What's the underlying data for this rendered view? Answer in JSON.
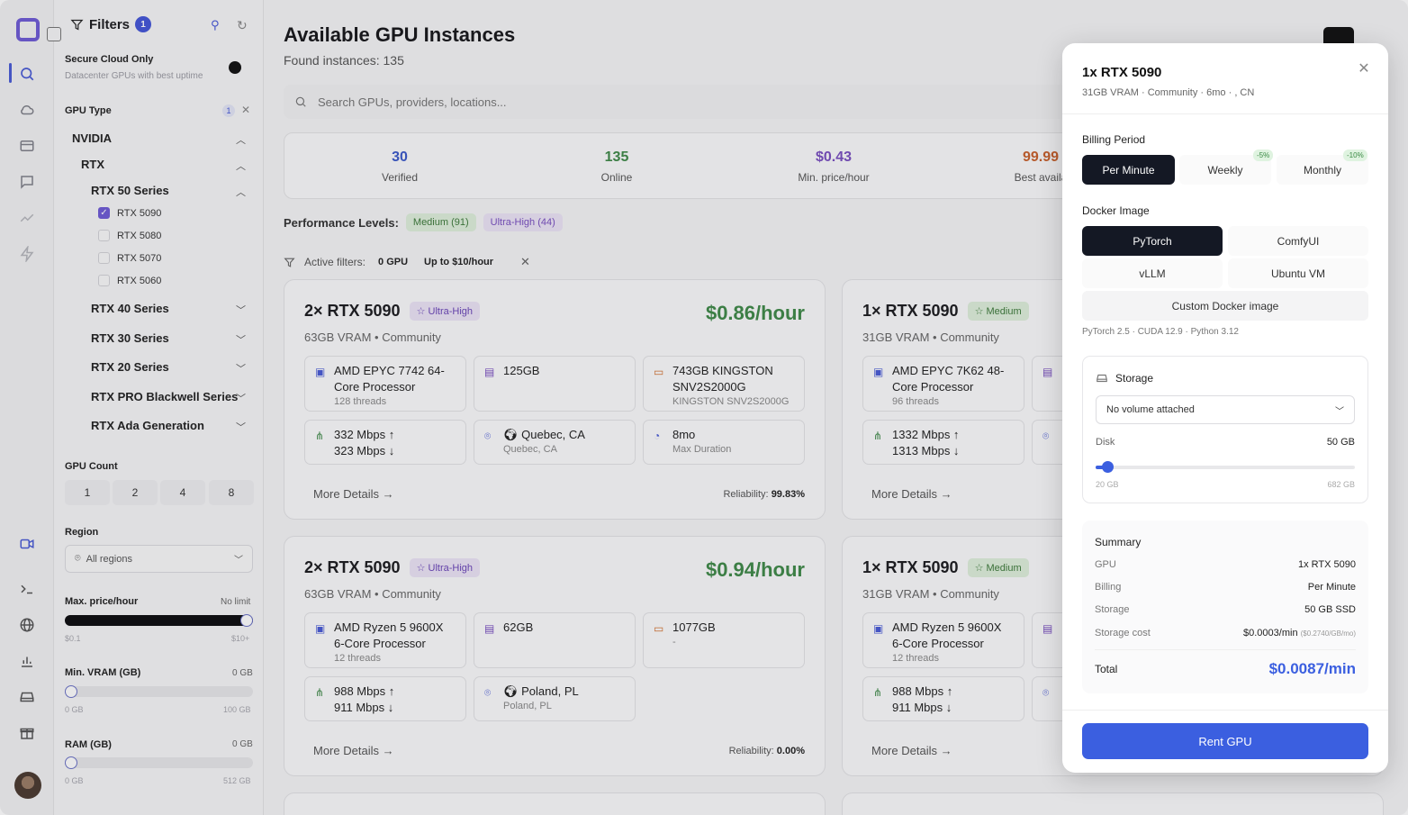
{
  "sidebar_filters": {
    "title": "Filters",
    "badge": "1",
    "secure_title": "Secure Cloud Only",
    "secure_desc": "Datacenter GPUs with best uptime",
    "gpu_type_label": "GPU Type",
    "gpu_type_count": "1",
    "vendor": "NVIDIA",
    "family": "RTX",
    "series_open": "RTX 50 Series",
    "models": [
      {
        "label": "RTX 5090",
        "checked": true
      },
      {
        "label": "RTX 5080",
        "checked": false
      },
      {
        "label": "RTX 5070",
        "checked": false
      },
      {
        "label": "RTX 5060",
        "checked": false
      }
    ],
    "series_closed": [
      "RTX 40 Series",
      "RTX 30 Series",
      "RTX 20 Series",
      "RTX PRO Blackwell Series",
      "RTX Ada Generation"
    ],
    "gpu_count_label": "GPU Count",
    "gpu_counts": [
      "1",
      "2",
      "4",
      "8"
    ],
    "region_label": "Region",
    "region_value": "All regions",
    "price_label": "Max. price/hour",
    "price_value": "No limit",
    "price_min": "$0.1",
    "price_max": "$10+",
    "price_fill": 1.0,
    "vram_label": "Min. VRAM (GB)",
    "vram_value": "0 GB",
    "vram_min": "0 GB",
    "vram_max": "100 GB",
    "ram_label": "RAM (GB)",
    "ram_value": "0 GB",
    "ram_min": "0 GB",
    "ram_max": "512 GB"
  },
  "main": {
    "title": "Available GPU Instances",
    "found": "Found instances: 135",
    "search_placeholder": "Search GPUs, providers, locations...",
    "stats": [
      {
        "value": "30",
        "label": "Verified",
        "color": "#3b59c9"
      },
      {
        "value": "135",
        "label": "Online",
        "color": "#3f8a48"
      },
      {
        "value": "$0.43",
        "label": "Min. price/hour",
        "color": "#7a4fc0"
      },
      {
        "value": "99.99",
        "label": "Best availa",
        "color": "#c8602b"
      }
    ],
    "perf_label": "Performance Levels:",
    "perf_medium": "Medium (91)",
    "perf_uh": "Ultra-High (44)",
    "active_label": "Active filters:",
    "active_chips": [
      "0 GPU",
      "Up to $10/hour"
    ],
    "more_details": "More Details",
    "reliability_label": "Reliability:"
  },
  "cards": [
    {
      "title": "2× RTX 5090",
      "tier": "Ultra-High",
      "price": "$0.86/hour",
      "sub": "63GB VRAM • Community",
      "cpu": "AMD EPYC 7742 64-Core Processor",
      "cpu_sub": "128 threads",
      "ram": "125GB",
      "disk": "743GB KINGSTON SNV2S2000G",
      "disk_sub": "KINGSTON SNV2S2000G",
      "net_up": "332 Mbps ↑",
      "net_down": "323 Mbps ↓",
      "loc": "Quebec, CA",
      "loc_sub": "Quebec, CA",
      "dur": "8mo",
      "dur_sub": "Max Duration",
      "reliability": "99.83%"
    },
    {
      "title": "1× RTX 5090",
      "tier": "Medium",
      "sub": "31GB VRAM • Community",
      "cpu": "AMD EPYC 7K62 48-Core Processor",
      "cpu_sub": "96 threads",
      "net_up": "1332 Mbps ↑",
      "net_down": "1313 Mbps ↓"
    },
    {
      "title": "2× RTX 5090",
      "tier": "Ultra-High",
      "price": "$0.94/hour",
      "sub": "63GB VRAM • Community",
      "cpu": "AMD Ryzen 5 9600X 6-Core Processor",
      "cpu_sub": "12 threads",
      "ram": "62GB",
      "disk": "1077GB",
      "disk_sub": "-",
      "net_up": "988 Mbps ↑",
      "net_down": "911 Mbps ↓",
      "loc": "Poland, PL",
      "loc_sub": "Poland, PL",
      "reliability": "0.00%"
    },
    {
      "title": "1× RTX 5090",
      "tier": "Medium",
      "sub": "31GB VRAM • Community",
      "cpu": "AMD Ryzen 5 9600X 6-Core Processor",
      "cpu_sub": "12 threads",
      "net_up": "988 Mbps ↑",
      "net_down": "911 Mbps ↓"
    }
  ],
  "modal": {
    "title": "1x RTX 5090",
    "subtitle": "31GB VRAM · Community · 6mo · , CN",
    "billing_label": "Billing Period",
    "billing_options": [
      "Per Minute",
      "Weekly",
      "Monthly"
    ],
    "weekly_discount": "-5%",
    "monthly_discount": "-10%",
    "docker_label": "Docker Image",
    "docker_options": [
      "PyTorch",
      "ComfyUI",
      "vLLM",
      "Ubuntu VM"
    ],
    "custom_docker": "Custom Docker image",
    "versions": "PyTorch 2.5 · CUDA 12.9 · Python 3.12",
    "storage_label": "Storage",
    "storage_select": "No volume attached",
    "disk_label": "Disk",
    "disk_value": "50 GB",
    "disk_min": "20 GB",
    "disk_max": "682 GB",
    "disk_fill": 0.046,
    "summary_title": "Summary",
    "summary": {
      "gpu_k": "GPU",
      "gpu_v": "1x RTX 5090",
      "billing_k": "Billing",
      "billing_v": "Per Minute",
      "storage_k": "Storage",
      "storage_v": "50 GB SSD",
      "cost_k": "Storage cost",
      "cost_v": "$0.0003/min",
      "cost_note": "($0.2740/GB/mo)",
      "total_k": "Total",
      "total_v": "$0.0087/min"
    },
    "rent_label": "Rent GPU"
  }
}
